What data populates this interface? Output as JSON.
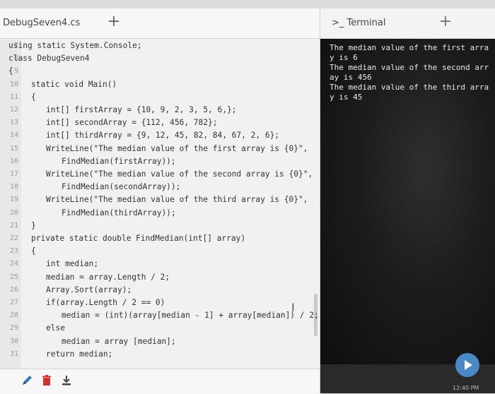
{
  "editor": {
    "file_name": "DebugSeven4.cs",
    "add_tab_label": "+",
    "lines": [
      {
        "num": "7",
        "text": "using static System.Console;",
        "indent": 0
      },
      {
        "num": "8",
        "text": "class DebugSeven4",
        "indent": 0
      },
      {
        "num": "9",
        "text": "{",
        "indent": 0
      },
      {
        "num": "10",
        "text": "static void Main()",
        "indent": 1
      },
      {
        "num": "11",
        "text": "{",
        "indent": 1
      },
      {
        "num": "12",
        "text": "int[] firstArray = {10, 9, 2, 3, 5, 6,};",
        "indent": 2
      },
      {
        "num": "13",
        "text": "int[] secondArray = {112, 456, 782};",
        "indent": 2
      },
      {
        "num": "14",
        "text": "int[] thirdArray = {9, 12, 45, 82, 84, 67, 2, 6};",
        "indent": 2
      },
      {
        "num": "15",
        "text": "WriteLine(\"The median value of the first array is {0}\",",
        "indent": 2
      },
      {
        "num": "16",
        "text": "FindMedian(firstArray));",
        "indent": 3
      },
      {
        "num": "17",
        "text": "WriteLine(\"The median value of the second array is {0}\",",
        "indent": 2
      },
      {
        "num": "18",
        "text": "FindMedian(secondArray));",
        "indent": 3
      },
      {
        "num": "19",
        "text": "WriteLine(\"The median value of the third array is {0}\",",
        "indent": 2
      },
      {
        "num": "20",
        "text": "FindMedian(thirdArray));",
        "indent": 3
      },
      {
        "num": "21",
        "text": "}",
        "indent": 1
      },
      {
        "num": "22",
        "text": "private static double FindMedian(int[] array)",
        "indent": 1
      },
      {
        "num": "23",
        "text": "{",
        "indent": 1
      },
      {
        "num": "24",
        "text": "int median;",
        "indent": 2
      },
      {
        "num": "25",
        "text": "median = array.Length / 2;",
        "indent": 2
      },
      {
        "num": "26",
        "text": "Array.Sort(array);",
        "indent": 2
      },
      {
        "num": "27",
        "text": "if(array.Length / 2 == 0)",
        "indent": 2
      },
      {
        "num": "28",
        "text": "median = (int)(array[median - 1] + array[median]) / 2;",
        "indent": 3
      },
      {
        "num": "29",
        "text": "else",
        "indent": 2
      },
      {
        "num": "30",
        "text": "median = array [median];",
        "indent": 3
      },
      {
        "num": "31",
        "text": "return median;",
        "indent": 2
      }
    ],
    "tools": [
      "pencil-icon",
      "trash-icon",
      "download-icon"
    ]
  },
  "terminal": {
    "title": ">_ Terminal",
    "add_label": "+",
    "output": [
      "The median value of the first arra",
      "y is 6",
      "The median value of the second arr",
      "ay is 456",
      "The median value of the third arra",
      "y is 45"
    ]
  },
  "clock": "12:40 PM",
  "colors": {
    "accent_play": "#4a89c7",
    "terminal_bg": "#141414",
    "editor_bg": "#f1f1f1"
  }
}
